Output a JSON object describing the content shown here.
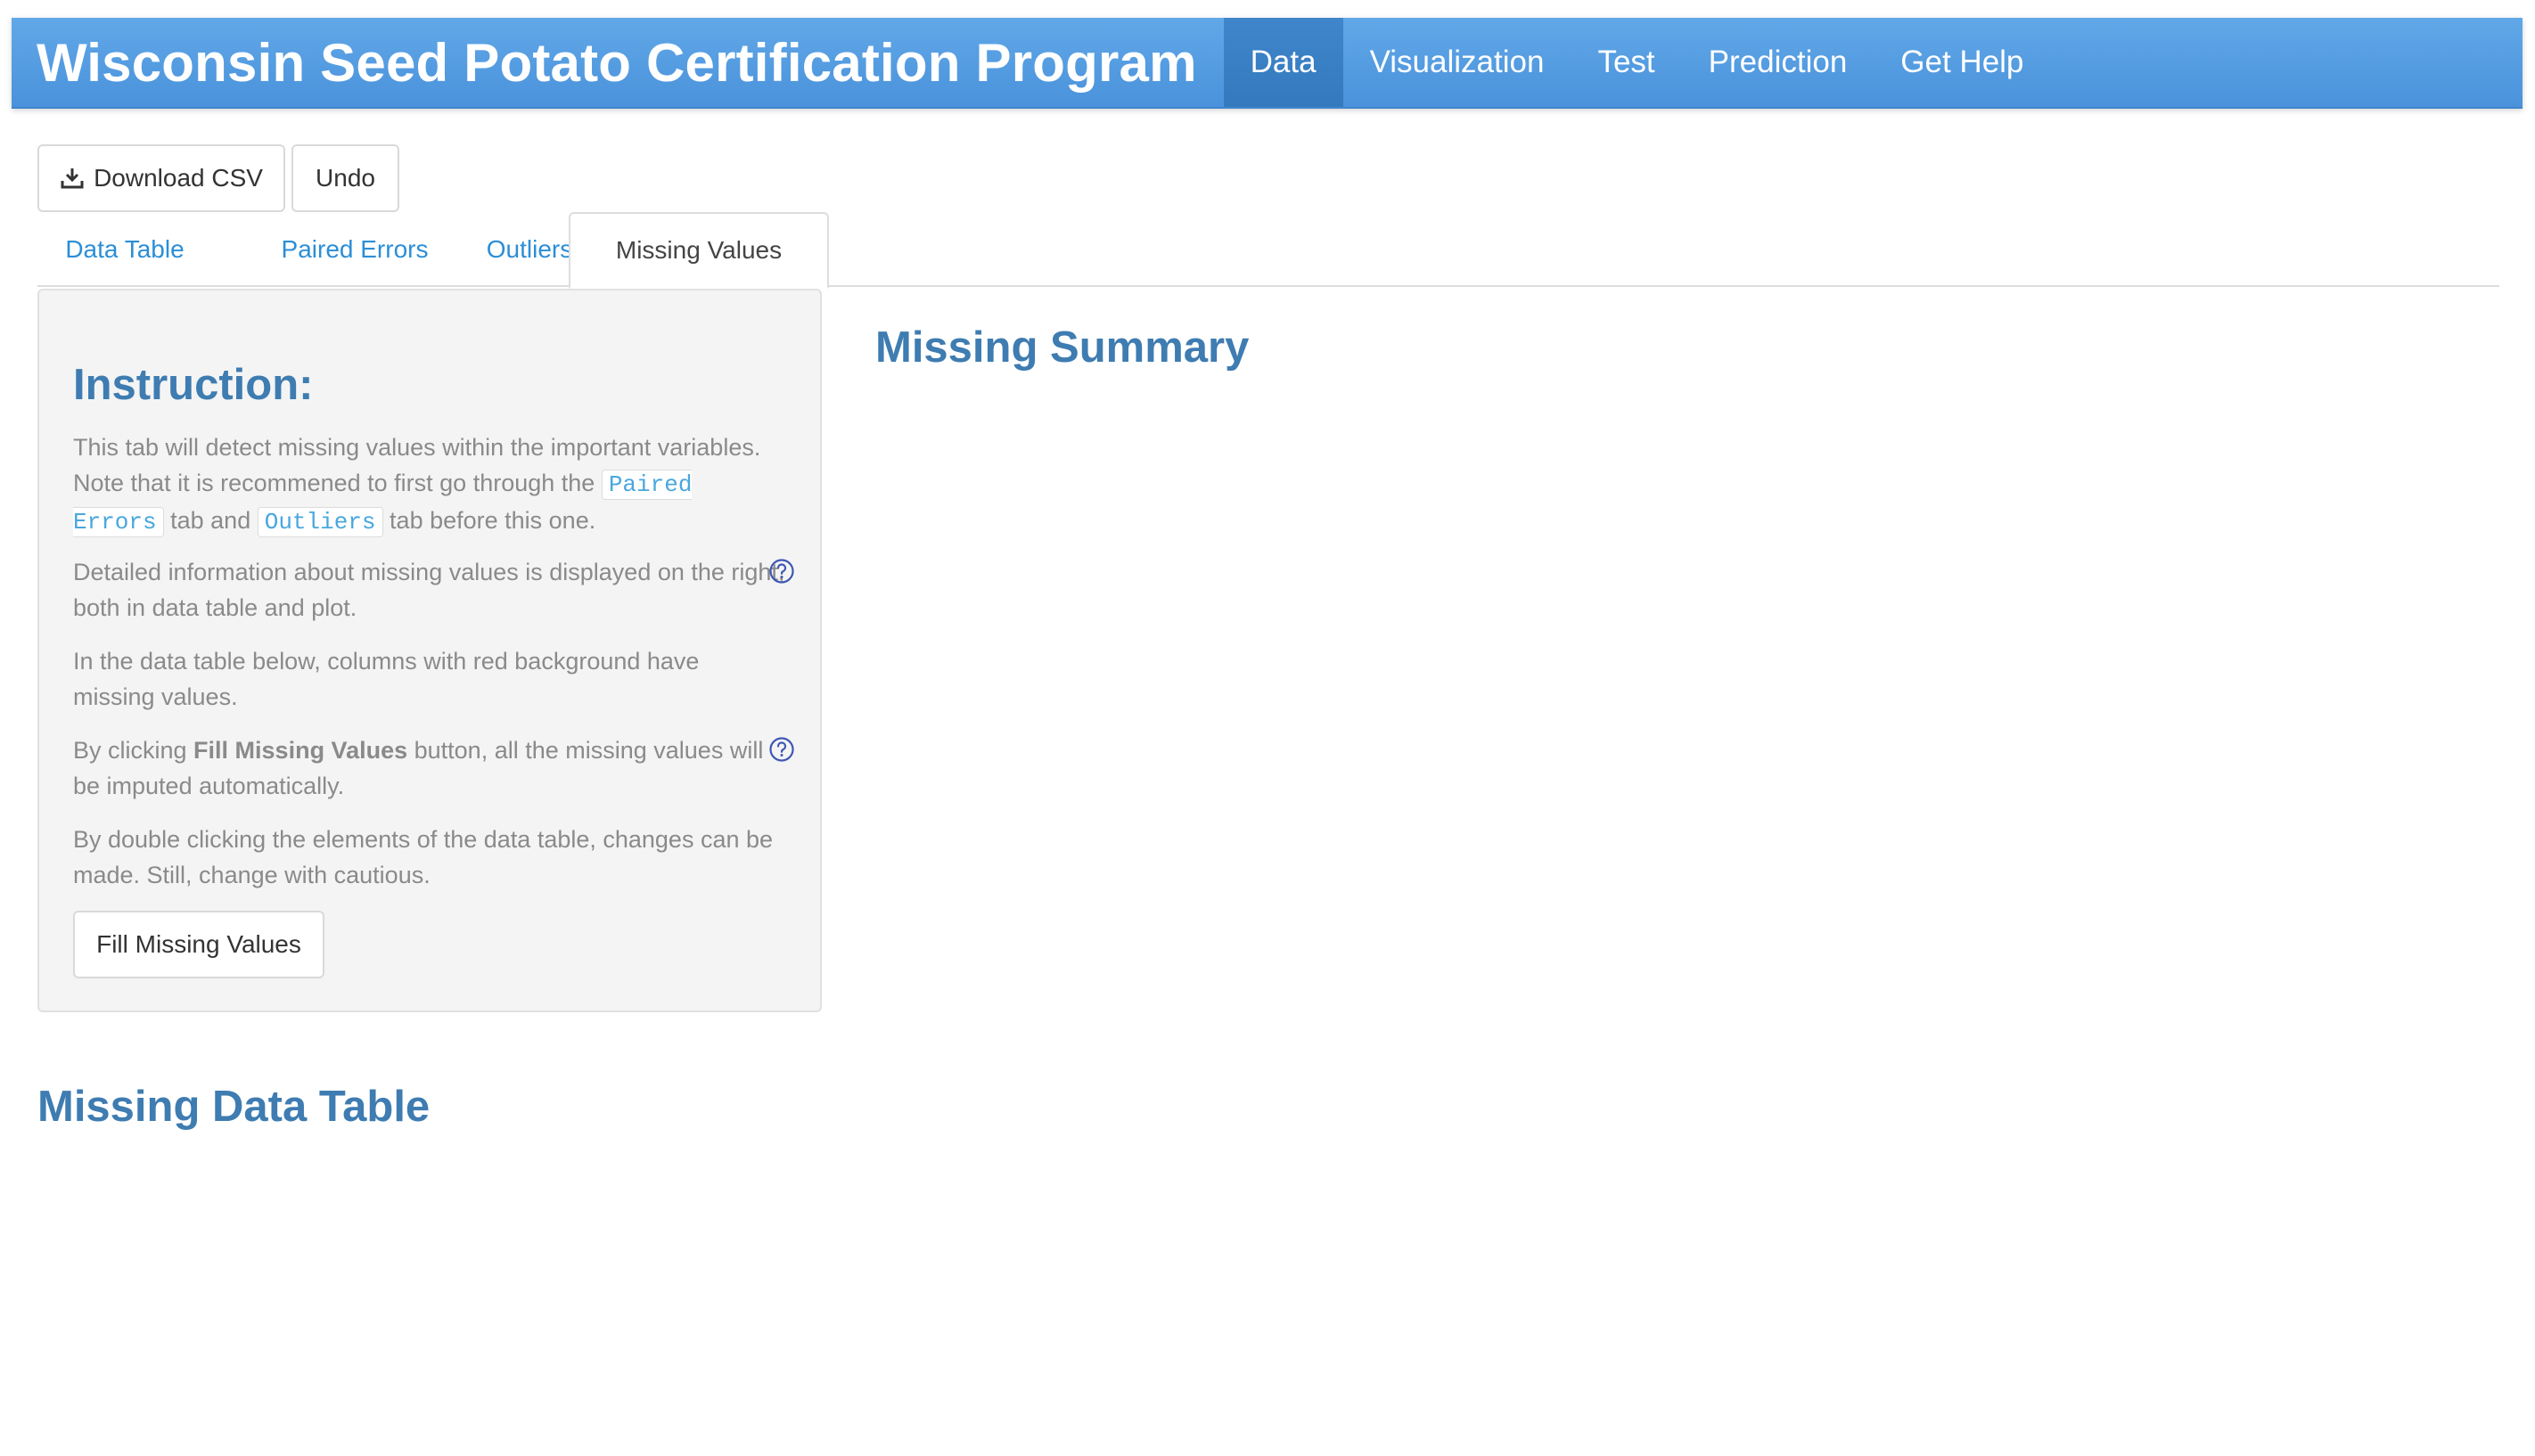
{
  "navbar": {
    "brand": "Wisconsin Seed Potato Certification Program",
    "items": [
      {
        "label": "Data",
        "active": true
      },
      {
        "label": "Visualization",
        "active": false
      },
      {
        "label": "Test",
        "active": false
      },
      {
        "label": "Prediction",
        "active": false
      },
      {
        "label": "Get Help",
        "active": false
      }
    ]
  },
  "toolbar": {
    "download_label": "Download CSV",
    "download_icon": "download-icon",
    "undo_label": "Undo"
  },
  "tabs": [
    {
      "label": "Data Table",
      "active": false
    },
    {
      "label": "Paired Errors",
      "active": false
    },
    {
      "label": "Outliers",
      "active": false
    },
    {
      "label": "Missing Values",
      "active": true
    }
  ],
  "sidebar": {
    "title": "Instruction:",
    "p1": {
      "before": "This tab will detect missing values within the important variables. Note that it is recommened to first go through the ",
      "code1": "Paired Errors",
      "between": " tab and ",
      "code2": "Outliers",
      "after": " tab before this one."
    },
    "p2": "Detailed information about missing values is displayed on the right, both in data table and plot.",
    "p3": "In the data table below, columns with red background have missing values.",
    "p4": {
      "before": "By clicking ",
      "bold": "Fill Missing Values",
      "after": " button, all the missing values will be imputed automatically."
    },
    "p5": "By double clicking the elements of the data table, changes can be made. Still, change with cautious.",
    "fill_button_label": "Fill Missing Values",
    "help_icon": "question-circle-icon"
  },
  "main": {
    "summary_heading": "Missing Summary",
    "table_heading": "Missing Data Table"
  },
  "colors": {
    "navbar": "#4a92db",
    "navbar_active": "#3479bd",
    "heading": "#3e7cb1",
    "tab_link": "#2c8ed6",
    "code_text": "#49a7de",
    "panel_bg": "#f4f4f4"
  }
}
